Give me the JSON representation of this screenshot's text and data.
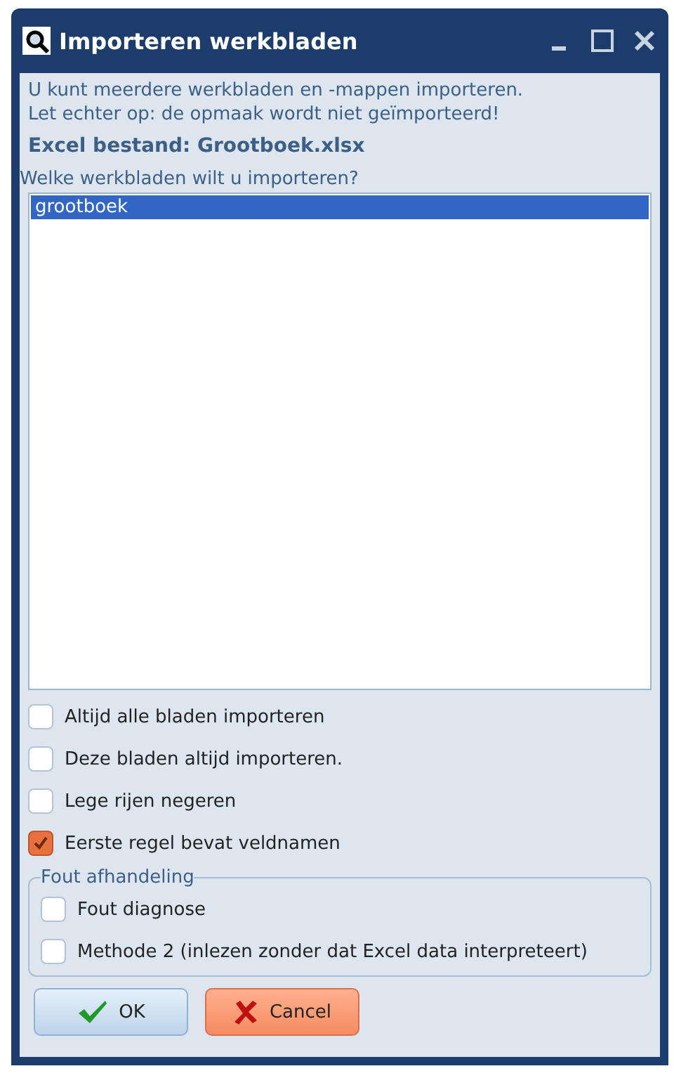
{
  "window": {
    "title": "Importeren werkbladen"
  },
  "intro": [
    "U kunt meerdere werkbladen en -mappen importeren.",
    "Let echter op: de opmaak wordt niet geïmporteerd!"
  ],
  "file_label": "Excel bestand: Grootboek.xlsx",
  "list": {
    "label": "Welke werkbladen wilt u importeren?",
    "items": [
      {
        "text": "grootboek",
        "selected": true
      }
    ]
  },
  "options": [
    {
      "label": "Altijd alle bladen importeren",
      "checked": false
    },
    {
      "label": "Deze bladen altijd importeren.",
      "checked": false
    },
    {
      "label": "Lege rijen negeren",
      "checked": false
    },
    {
      "label": "Eerste regel bevat veldnamen",
      "checked": true
    }
  ],
  "group": {
    "title": "Fout afhandeling",
    "options": [
      {
        "label": "Fout diagnose",
        "checked": false
      },
      {
        "label": "Methode 2 (inlezen zonder dat Excel data interpreteert)",
        "checked": false
      }
    ]
  },
  "buttons": [
    {
      "kind": "ok",
      "label": "OK"
    },
    {
      "kind": "cancel",
      "label": "Cancel"
    }
  ]
}
